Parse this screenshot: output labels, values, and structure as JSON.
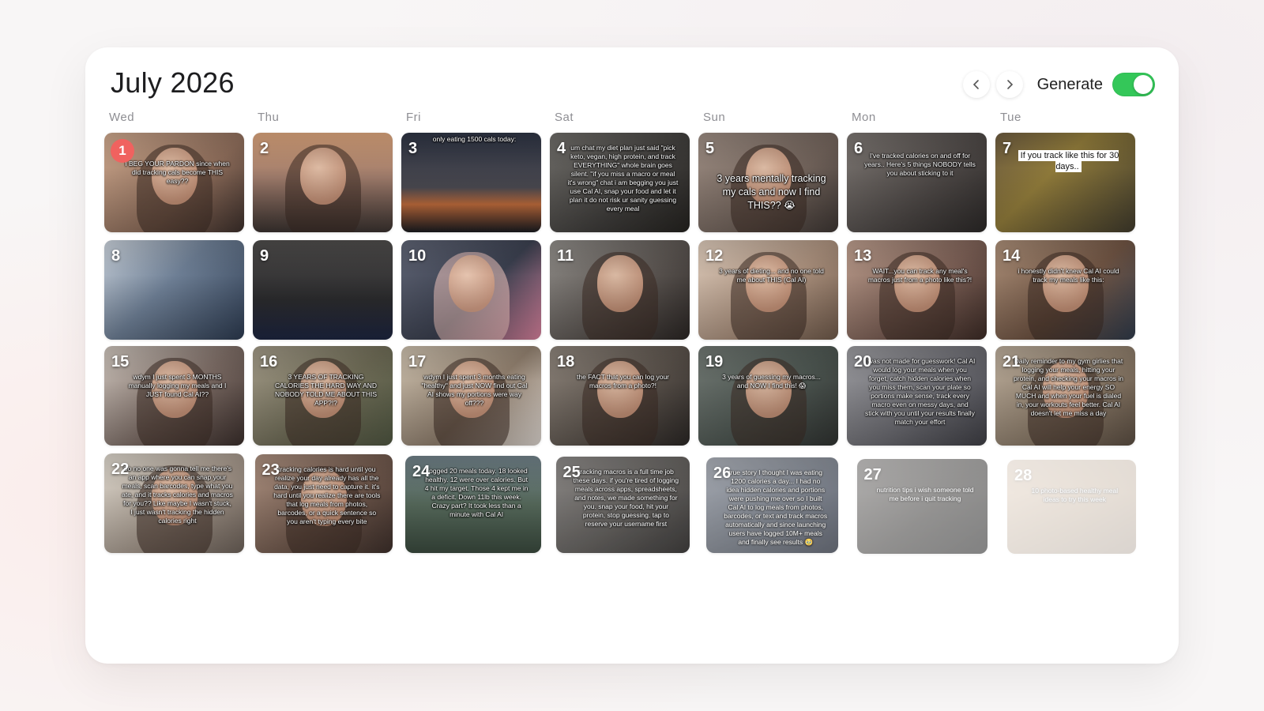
{
  "header": {
    "title": "July 2026",
    "prev_icon": "chevron-left-icon",
    "next_icon": "chevron-right-icon",
    "generate_label": "Generate",
    "generate_on": true,
    "toggle_color": "#34c759"
  },
  "weekdays": [
    "Wed",
    "Thu",
    "Fri",
    "Sat",
    "Sun",
    "Mon",
    "Tue"
  ],
  "today_color": "#f0625f",
  "days": [
    {
      "n": "1",
      "caption": "I BEG YOUR PARDON since when did tracking cals become THIS easy??",
      "bg": "linear-gradient(135deg,#c9a48a,#8a6a58 60%,#3b2e2a)"
    },
    {
      "n": "2",
      "caption": "",
      "bg": "linear-gradient(180deg,#d8a27a 0%,#9d7a6a 45%,#3a3230 100%)"
    },
    {
      "n": "3",
      "caption": "only eating 1500 cals today:",
      "bg": "linear-gradient(180deg,#2d3342 0%,#49484f 55%,#b9683a 72%,#1a1b20 100%)"
    },
    {
      "n": "4",
      "caption": "um chat my diet plan just said \"pick keto, vegan, high protein, and track EVERYTHING\" whole brain goes silent. \"if you miss a macro or meal it's wrong\" chat i am begging you just use Cal AI, snap your food and let it plan it do not risk ur sanity guessing every meal",
      "bg": "linear-gradient(135deg,#6c6a66,#3e3c3a 60%,#24221f)"
    },
    {
      "n": "5",
      "caption": "3 years mentally tracking my cals and now I find THIS?? 😭",
      "bg": "linear-gradient(135deg,#9a8a80,#6e6058 60%,#3d3633)"
    },
    {
      "n": "6",
      "caption": "I've tracked calories on and off for years.. Here's 5 things NOBODY tells you about sticking to it",
      "bg": "linear-gradient(135deg,#7a7470,#4a4543 60%,#2b2827)"
    },
    {
      "n": "7",
      "caption": "If you track like this for 30 days..",
      "bg": "linear-gradient(135deg,#6b5a3f,#8f7a3a 40%,#3f3a2c 100%)"
    },
    {
      "n": "8",
      "caption": "",
      "bg": "linear-gradient(135deg,#c7cfd8,#6d7e94 45%,#2c3a4f)"
    },
    {
      "n": "9",
      "caption": "",
      "bg": "linear-gradient(180deg,#4d4b4a,#2a2a2c 60%,#1d2540)"
    },
    {
      "n": "10",
      "caption": "",
      "bg": "linear-gradient(135deg,#5d6272,#3a3f4e 55%,#d47f9a 100%)"
    },
    {
      "n": "11",
      "caption": "",
      "bg": "linear-gradient(135deg,#8d8a86,#5b5551 55%,#2a2523)"
    },
    {
      "n": "12",
      "caption": "3 years of dieting... and no one told me about THIS (Cal AI)",
      "bg": "linear-gradient(135deg,#d8c6b6,#a98f7c 55%,#6d5849)"
    },
    {
      "n": "13",
      "caption": "WAIT...you can track any meal's macros just from a photo like this?!",
      "bg": "linear-gradient(135deg,#b89a8a,#7b5f55 55%,#3b2a25)"
    },
    {
      "n": "14",
      "caption": "i honestly didn't knew Cal AI could track my meals like this:",
      "bg": "linear-gradient(135deg,#a88c76,#6f5443 55%,#2f3a4a)"
    },
    {
      "n": "15",
      "caption": "wdym I just spent 3 MONTHS manually logging my meals and I JUST found Cal AI??",
      "bg": "linear-gradient(135deg,#c9c0b8,#7a6a63 55%,#3a2e2b)"
    },
    {
      "n": "16",
      "caption": "3 YEARS OF TRACKING CALORIES THE HARD WAY AND NOBODY TOLD ME ABOUT THIS APP?!?",
      "bg": "linear-gradient(135deg,#9e9684,#6d6a55 55%,#4e5540)"
    },
    {
      "n": "17",
      "caption": "wdym I just spent 3 months eating \"healthy\" and just NOW find out Cal AI shows my portions were way off???",
      "bg": "linear-gradient(135deg,#c7bba9,#8f7e6d 55%,#d9d2cc)"
    },
    {
      "n": "18",
      "caption": "the FACT that you can log your macros from a photo?!",
      "bg": "linear-gradient(135deg,#8a8178,#5a524b 55%,#2a2624)"
    },
    {
      "n": "19",
      "caption": "3 years of guessing my macros... and NOW I find this! 😱",
      "bg": "linear-gradient(135deg,#6e7570,#4c5550 55%,#2f3230)"
    },
    {
      "n": "20",
      "caption": "i was not made for guesswork! Cal AI would log your meals when you forget, catch hidden calories when you miss them, scan your plate so portions make sense, track every macro even on messy days, and stick with you until your results finally match your effort",
      "bg": "linear-gradient(135deg,#98989c,#6a6a70 55%,#3e3e44)"
    },
    {
      "n": "21",
      "caption": "Daily reminder to my gym girlies that logging your meals, hitting your protein, and checking your macros in Cal AI will help your energy SO MUCH and when your fuel is dialed in, your workouts feel better. Cal AI doesn't let me miss a day",
      "bg": "linear-gradient(135deg,#b6a897,#8a7a68 55%,#5a4d41)"
    },
    {
      "n": "22",
      "caption": "So no one was gonna tell me there's an app where you can snap your meals, scan barcodes, type what you ate, and it tracks calories and macros for you?? Like maybe I wasn't stuck, I just wasn't tracking the hidden calories right",
      "bg": "linear-gradient(135deg,#d8d2c8,#a3968a 55%,#6b6058)"
    },
    {
      "n": "23",
      "caption": "tracking calories is hard until you realize your day already has all the data, you just need to capture it. it's hard until you realize there are tools that log meals from photos, barcodes, or a quick sentence so you aren't typing every bite",
      "bg": "linear-gradient(135deg,#a78c7c,#6f584c 55%,#3d2f2a)"
    },
    {
      "n": "24",
      "caption": "Logged 20 meals today. 18 looked healthy. 12 were over calories. But 4 hit my target. Those 4 kept me in a deficit. Down 11lb this week. Crazy part? It took less than a minute with Cal AI",
      "bg": "linear-gradient(180deg,#6f7f87,#55685a 50%,#3a4a3e 100%)"
    },
    {
      "n": "25",
      "caption": "tracking macros is a full time job these days. if you're tired of logging meals across apps, spreadsheets, and notes, we made something for you. snap your food, hit your protein, stop guessing. tap to reserve your username first",
      "bg": "linear-gradient(135deg,#7d7a78,#55524f 55%,#2e2c2b)"
    },
    {
      "n": "26",
      "caption": "true story I thought I was eating 1200 calories a day... I had no idea hidden calories and portions were pushing me over so I built Cal AI to log meals from photos, barcodes, or text and track macros automatically and since launching users have logged 10M+ meals and finally see results 🥹",
      "bg": "linear-gradient(135deg,#8a8f99,#5f6672 55%,#3c4250)"
    },
    {
      "n": "27",
      "caption": "nutrition tips i wish someone told me before i quit tracking",
      "bg": "linear-gradient(135deg,#6f6c6a,#3f3d3b 55%,#222)"
    },
    {
      "n": "28",
      "caption": "10 photo-based healthy meal ideas to try this week",
      "bg": "linear-gradient(135deg,#c6a27f,#9a7650 55%,#6e4e31)"
    }
  ]
}
